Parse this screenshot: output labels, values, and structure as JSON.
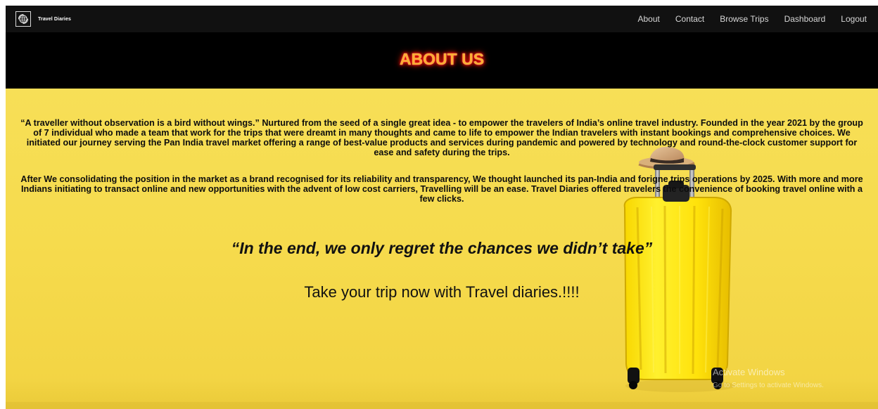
{
  "brand": {
    "name": "Travel Diaries",
    "logo_icon": "globe-icon"
  },
  "nav": {
    "items": [
      {
        "label": "About"
      },
      {
        "label": "Contact"
      },
      {
        "label": "Browse Trips"
      },
      {
        "label": "Dashboard"
      },
      {
        "label": "Logout"
      }
    ]
  },
  "page": {
    "title": "ABOUT US"
  },
  "about": {
    "paragraphs": [
      "“A traveller without observation is a bird without wings.” Nurtured from the seed of a single great idea - to empower the travelers of India’s online travel industry. Founded in the year 2021 by the group of 7 individual who made a team that work for the trips that were dreamt in many thoughts and came to life to empower the Indian travelers with instant bookings and comprehensive choices. We initiated our journey serving the Pan India travel market offering a range of best-value products and services during pandemic and powered by technology and round-the-clock customer support for ease and safety during the trips.",
      "After We consolidating the position in the market as a brand recognised for its reliability and transparency, We thought launched its pan-India and forigne trips operations by 2025. With more and more Indians initiating to transact online and new opportunities with the advent of low cost carriers, Travelling will be an ease. Travel Diaries offered travelers the convenience of booking travel online with a few clicks."
    ],
    "quote": "“In the end, we only regret the chances we didn’t take”",
    "cta": "Take your trip now with Travel diaries.!!!!"
  },
  "system": {
    "watermark_title": "Activate Windows",
    "watermark_subtitle": "Go to Settings to activate Windows."
  },
  "icons": {
    "luggage": "suitcase-icon",
    "hat": "hat-icon"
  },
  "colors": {
    "nav_bg": "#111111",
    "header_bg": "#000000",
    "title_orange": "#ffad33",
    "title_glow": "#ff0000",
    "hero_yellow": "#f6db4d",
    "suitcase_yellow": "#ffe21a",
    "text_dark": "#0d0d0d"
  }
}
